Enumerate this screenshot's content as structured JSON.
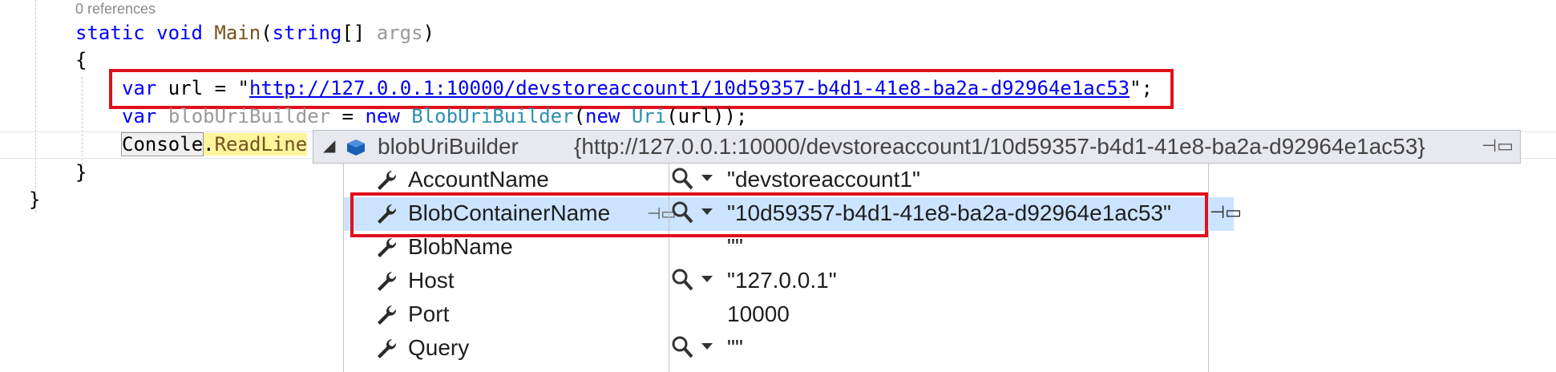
{
  "code": {
    "codelens": "0 references",
    "line1": {
      "static": "static",
      "void": "void",
      "method": "Main",
      "open": "(",
      "type": "string",
      "brackets": "[] ",
      "param": "args",
      "close": ")"
    },
    "open_brace": "{",
    "line2": {
      "var": "var",
      "rest": " url = \"",
      "url": "http://127.0.0.1:10000/devstoreaccount1/10d59357-b4d1-41e8-ba2a-d92964e1ac53",
      "end": "\";"
    },
    "line3": {
      "var": "var",
      "name": "blobUriBuilder",
      "eq": " = ",
      "new1": "new",
      "type1": "BlobUriBuilder",
      "p1": "(",
      "new2": "new",
      "type2": "Uri",
      "arg": "(url));"
    },
    "line4": {
      "console": "Console",
      "dot": ".",
      "method": "ReadLine"
    },
    "close_inner": "}",
    "close_outer": "}"
  },
  "datatip": {
    "header_name": "blobUriBuilder",
    "header_value": "{http://127.0.0.1:10000/devstoreaccount1/10d59357-b4d1-41e8-ba2a-d92964e1ac53}",
    "rows": [
      {
        "name": "AccountName",
        "value": "\"devstoreaccount1\""
      },
      {
        "name": "BlobContainerName",
        "value": "\"10d59357-b4d1-41e8-ba2a-d92964e1ac53\""
      },
      {
        "name": "BlobName",
        "value": "\"\""
      },
      {
        "name": "Host",
        "value": "\"127.0.0.1\""
      },
      {
        "name": "Port",
        "value": "10000"
      },
      {
        "name": "Query",
        "value": "\"\""
      }
    ]
  },
  "colors": {
    "highlight_box": "#e0101c",
    "selection": "#cce4ff",
    "keyword": "#0000ff",
    "type": "#2b91af"
  }
}
